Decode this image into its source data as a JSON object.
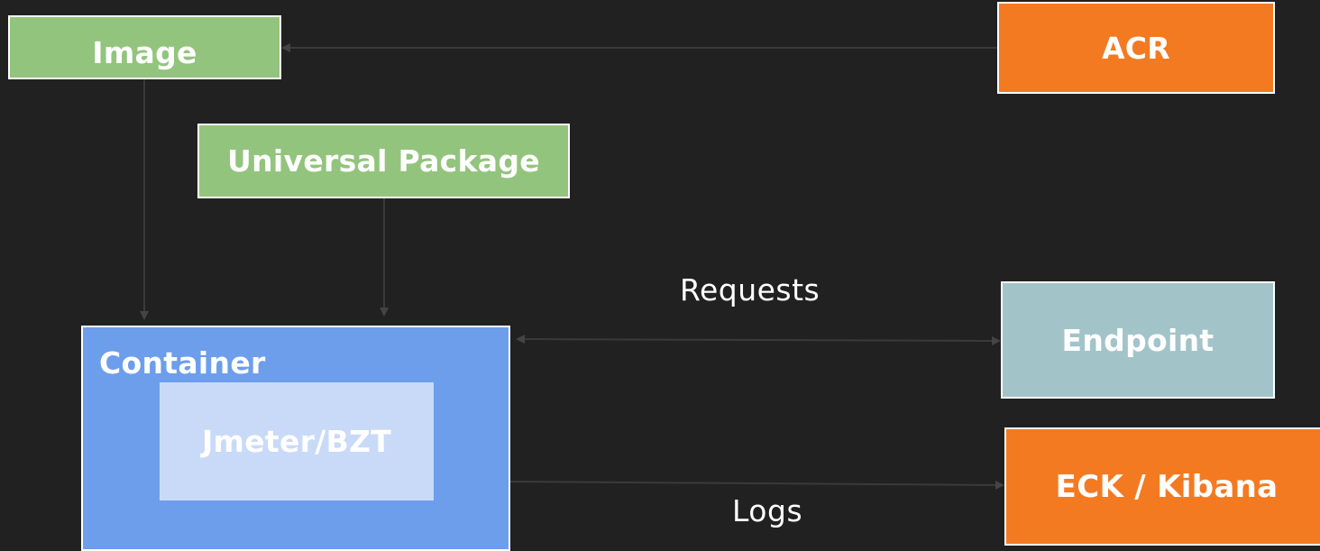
{
  "nodes": {
    "image": "Image",
    "acr": "ACR",
    "universal_package": "Universal Package",
    "container": "Container",
    "jmeter": "Jmeter/BZT",
    "endpoint": "Endpoint",
    "eck": "ECK / Kibana"
  },
  "edges": {
    "requests": "Requests",
    "logs": "Logs"
  },
  "colors": {
    "background": "#212121",
    "green": "#93c47d",
    "orange": "#f47a22",
    "teal": "#a2c4c9",
    "container_blue": "#6d9eeb",
    "inner_blue": "#c9daf8",
    "connector": "#3a3a3a"
  }
}
